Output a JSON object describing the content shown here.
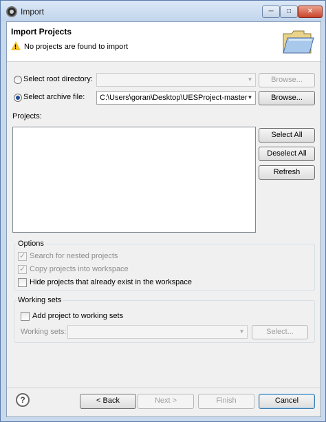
{
  "window": {
    "title": "Import",
    "controls": {
      "minimize": "─",
      "maximize": "□",
      "close": "✕"
    }
  },
  "header": {
    "title": "Import Projects",
    "message": "No projects are found to import",
    "message_icon": "warning-icon"
  },
  "source": {
    "root_directory": {
      "label": "Select root directory:",
      "value": "",
      "selected": false,
      "browse_label": "Browse..."
    },
    "archive_file": {
      "label": "Select archive file:",
      "value": "C:\\Users\\goran\\Desktop\\UESProject-master",
      "selected": true,
      "browse_label": "Browse..."
    }
  },
  "projects": {
    "label": "Projects:",
    "items": [],
    "buttons": {
      "select_all": "Select All",
      "deselect_all": "Deselect All",
      "refresh": "Refresh"
    }
  },
  "options": {
    "title": "Options",
    "search_nested": {
      "label": "Search for nested projects",
      "checked": true,
      "enabled": false
    },
    "copy_projects": {
      "label": "Copy projects into workspace",
      "checked": true,
      "enabled": false
    },
    "hide_existing": {
      "label": "Hide projects that already exist in the workspace",
      "checked": false,
      "enabled": true
    }
  },
  "working_sets": {
    "title": "Working sets",
    "add_to_working_sets": {
      "label": "Add project to working sets",
      "checked": false
    },
    "field_label": "Working sets:",
    "value": "",
    "select_label": "Select..."
  },
  "footer": {
    "back": "< Back",
    "next": "Next >",
    "finish": "Finish",
    "cancel": "Cancel"
  },
  "colors": {
    "window_frame": "#c9d9ec",
    "dialog_bg": "#f0f0f0",
    "warning": "#f2c028",
    "default_button_border": "#3c7fb1"
  }
}
